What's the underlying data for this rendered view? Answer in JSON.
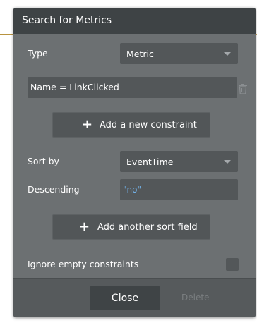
{
  "dialog": {
    "title": "Search for Metrics"
  },
  "type_field": {
    "label": "Type",
    "value": "Metric"
  },
  "constraint": {
    "text": "Name =  LinkClicked"
  },
  "add_constraint_button": {
    "label": "Add a new constraint"
  },
  "sort_by": {
    "label": "Sort by",
    "value": "EventTime"
  },
  "descending": {
    "label": "Descending",
    "value": "\"no\""
  },
  "add_sort_field_button": {
    "label": "Add another sort field"
  },
  "ignore_empty": {
    "label": "Ignore empty constraints",
    "checked": false
  },
  "footer": {
    "close_label": "Close",
    "delete_label": "Delete"
  },
  "colors": {
    "dialog_bg": "#6c7072",
    "header_bg": "#3e4345",
    "field_bg": "#535759",
    "dynamic_value": "#72b3ea",
    "page_rule": "#b8933f"
  },
  "icons": {
    "caret": "caret-down-icon",
    "trash": "trash-icon",
    "plus": "plus-icon"
  }
}
